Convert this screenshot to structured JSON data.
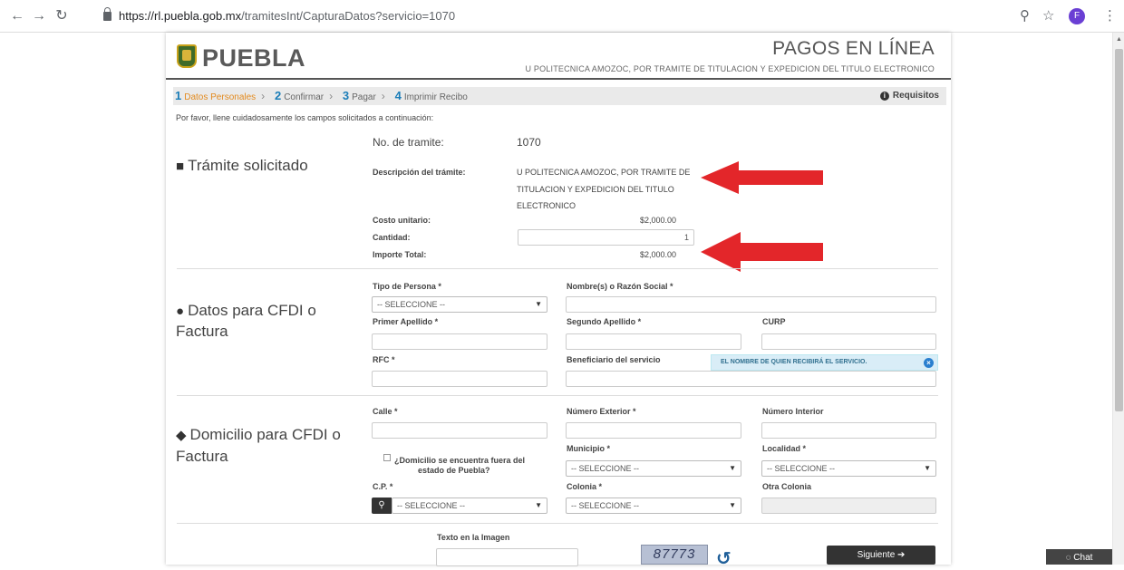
{
  "browser": {
    "url_host": "https://rl.puebla.gob.mx",
    "url_path": "/tramitesInt/CapturaDatos?servicio=1070",
    "profile_initial": "F",
    "chat_label": "Chat"
  },
  "header": {
    "logo": "PUEBLA",
    "title": "PAGOS EN LÍNEA",
    "subtitle": "U POLITECNICA AMOZOC, POR TRAMITE DE TITULACION Y EXPEDICION DEL TITULO ELECTRONICO"
  },
  "steps": [
    {
      "num": "1",
      "label": "Datos Personales"
    },
    {
      "num": "2",
      "label": "Confirmar"
    },
    {
      "num": "3",
      "label": "Pagar"
    },
    {
      "num": "4",
      "label": "Imprimir Recibo"
    }
  ],
  "requisitos_label": "Requisitos",
  "instructions": "Por favor, llene cuidadosamente los campos solicitados a continuación:",
  "tramite": {
    "section_title": "Trámite solicitado",
    "no_label": "No. de tramite:",
    "no_value": "1070",
    "desc_label": "Descripción del trámite:",
    "desc_lines": [
      "U POLITECNICA AMOZOC, POR TRAMITE DE",
      "TITULACION Y EXPEDICION DEL TITULO",
      "ELECTRONICO"
    ],
    "costo_label": "Costo unitario:",
    "costo_value": "$2,000.00",
    "cantidad_label": "Cantidad:",
    "cantidad_value": "1",
    "importe_label": "Importe Total:",
    "importe_value": "$2,000.00"
  },
  "cfdi": {
    "section_title_1": "Datos para CFDI o",
    "section_title_2": "Factura",
    "tipo_persona_label": "Tipo de Persona *",
    "tipo_persona_value": "-- SELECCIONE --",
    "nombre_label": "Nombre(s) o Razón Social *",
    "primer_apellido_label": "Primer Apellido *",
    "segundo_apellido_label": "Segundo Apellido *",
    "curp_label": "CURP",
    "rfc_label": "RFC *",
    "beneficiario_label": "Beneficiario del servicio",
    "beneficiario_tooltip": "EL NOMBRE DE QUIEN RECIBIRÁ EL SERVICIO."
  },
  "domicilio": {
    "section_title_1": "Domicilio para CFDI o",
    "section_title_2": "Factura",
    "calle_label": "Calle *",
    "num_ext_label": "Número Exterior *",
    "num_int_label": "Número Interior",
    "fuera_label_1": "¿Domicilio se encuentra fuera del",
    "fuera_label_2": "estado de Puebla?",
    "municipio_label": "Municipio *",
    "municipio_value": "-- SELECCIONE --",
    "localidad_label": "Localidad *",
    "localidad_value": "-- SELECCIONE --",
    "cp_label": "C.P. *",
    "cp_value": "-- SELECCIONE --",
    "colonia_label": "Colonia *",
    "colonia_value": "-- SELECCIONE --",
    "otra_colonia_label": "Otra Colonia"
  },
  "captcha": {
    "label": "Texto en la Imagen",
    "code": "87773",
    "submit_label": "Siguiente"
  }
}
